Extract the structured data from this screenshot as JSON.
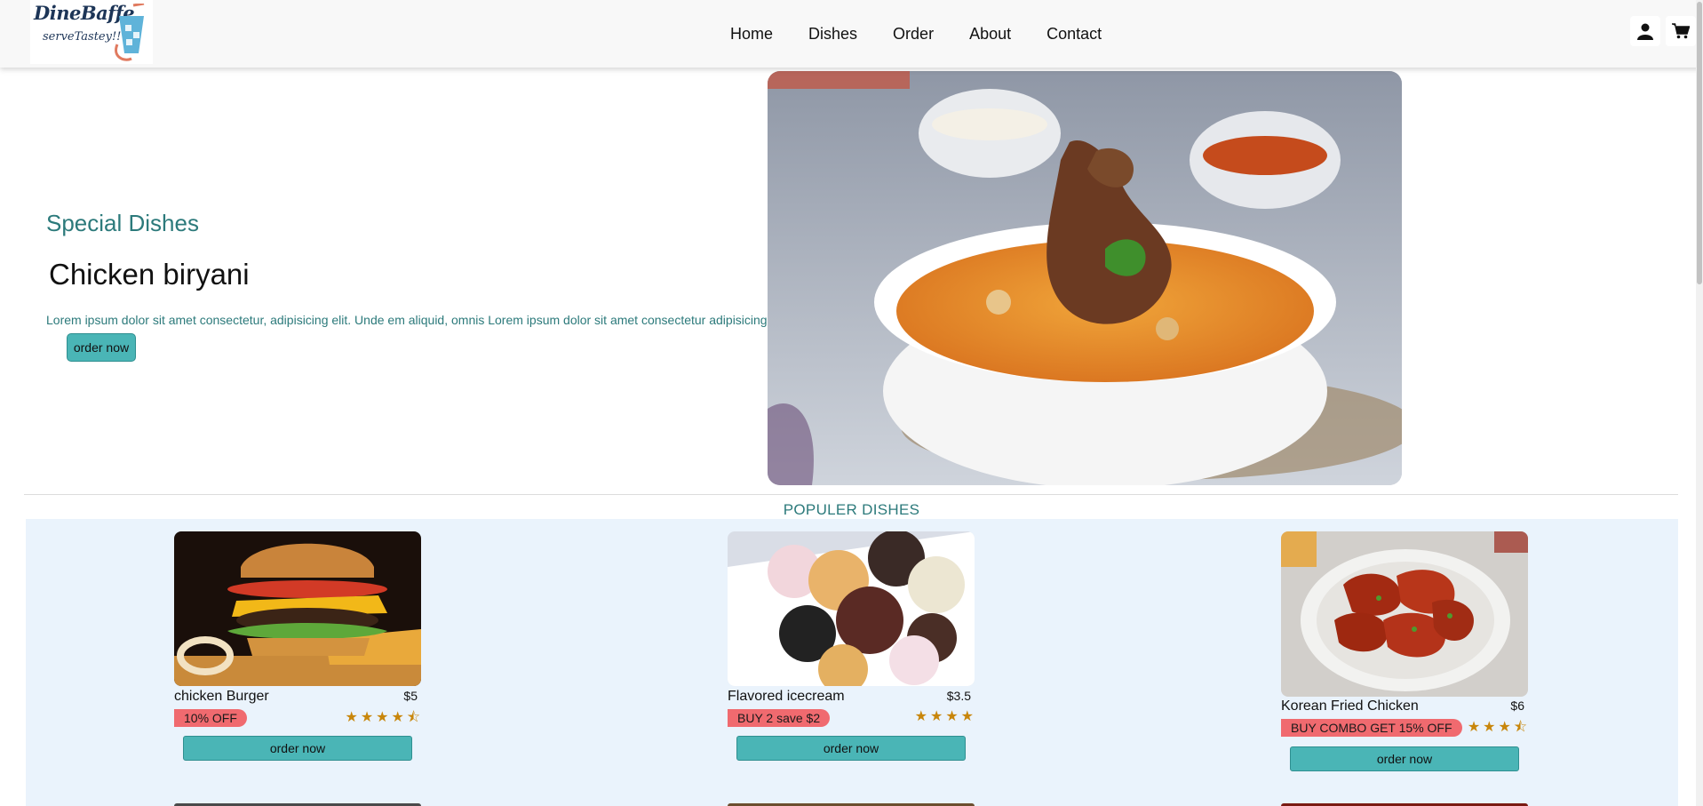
{
  "brand": {
    "name": "DineBaffe",
    "tagline": "serveTastey!!"
  },
  "nav": {
    "items": [
      "Home",
      "Dishes",
      "Order",
      "About",
      "Contact"
    ]
  },
  "icons": {
    "user": "user-icon",
    "cart": "cart-icon"
  },
  "hero": {
    "label": "Special Dishes",
    "title": "Chicken biryani",
    "description": "Lorem ipsum dolor sit amet consectetur, adipisicing elit. Unde em aliquid, omnis Lorem ipsum dolor sit amet consectetur adipisicing",
    "button": "order now"
  },
  "popular": {
    "heading": "POPULER DISHES",
    "cards": [
      {
        "name": "chicken Burger",
        "price": "$5",
        "badge": "10% OFF",
        "rating": 4.5,
        "stars": "★★★★⯪",
        "button": "order now"
      },
      {
        "name": "Flavored icecream",
        "price": "$3.5",
        "badge": "BUY 2 save $2",
        "rating": 4,
        "stars": "★★★★",
        "button": "order now"
      },
      {
        "name": "Korean Fried Chicken",
        "price": "$6",
        "badge": "BUY COMBO GET 15% OFF",
        "rating": 3.5,
        "stars": "★★★⯪",
        "button": "order now"
      }
    ]
  },
  "colors": {
    "accent": "#4ab5b6",
    "teal_text": "#2c7a7b",
    "badge": "#f06a6f",
    "star": "#c8860b",
    "section_bg": "#eaf3fc"
  }
}
